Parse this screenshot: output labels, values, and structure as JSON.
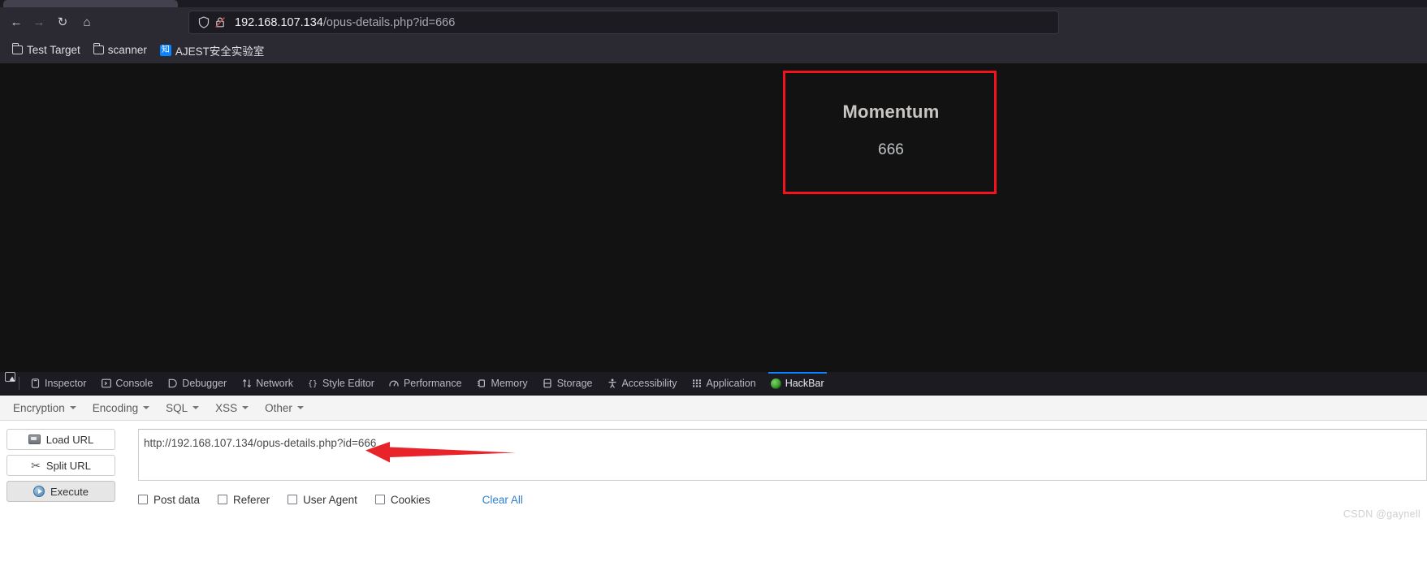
{
  "browser": {
    "nav": {
      "back_label": "←",
      "forward_label": "→",
      "reload_label": "↻",
      "home_label": "⌂"
    },
    "urlbar": {
      "host": "192.168.107.134",
      "path": "/opus-details.php?id=666",
      "shield_icon": "shield-icon",
      "lock_icon": "lock-crossed-icon"
    },
    "bookmarks": [
      {
        "label": "Test Target",
        "icon": "folder-icon"
      },
      {
        "label": "scanner",
        "icon": "folder-icon"
      },
      {
        "label": "AJEST安全实验室",
        "icon": "site-favicon",
        "favicon_text": "知"
      }
    ]
  },
  "page": {
    "title": "Momentum",
    "value": "666",
    "background": "#121212",
    "annotation_box_color": "#f5121a"
  },
  "devtools": {
    "picker_icon": "element-picker-icon",
    "tabs": [
      {
        "label": "Inspector",
        "icon": "inspector-icon",
        "active": false
      },
      {
        "label": "Console",
        "icon": "console-icon",
        "active": false
      },
      {
        "label": "Debugger",
        "icon": "debugger-icon",
        "active": false
      },
      {
        "label": "Network",
        "icon": "network-icon",
        "active": false
      },
      {
        "label": "Style Editor",
        "icon": "style-editor-icon",
        "active": false
      },
      {
        "label": "Performance",
        "icon": "performance-icon",
        "active": false
      },
      {
        "label": "Memory",
        "icon": "memory-icon",
        "active": false
      },
      {
        "label": "Storage",
        "icon": "storage-icon",
        "active": false
      },
      {
        "label": "Accessibility",
        "icon": "accessibility-icon",
        "active": false
      },
      {
        "label": "Application",
        "icon": "application-icon",
        "active": false
      },
      {
        "label": "HackBar",
        "icon": "hackbar-icon",
        "active": true
      }
    ],
    "active_tab_accent": "#0a84ff"
  },
  "hackbar": {
    "menus": [
      {
        "label": "Encryption"
      },
      {
        "label": "Encoding"
      },
      {
        "label": "SQL"
      },
      {
        "label": "XSS"
      },
      {
        "label": "Other"
      }
    ],
    "buttons": [
      {
        "label": "Load URL",
        "icon": "load-url-icon",
        "primary": false
      },
      {
        "label": "Split URL",
        "icon": "scissors-icon",
        "primary": false
      },
      {
        "label": "Execute",
        "icon": "play-icon",
        "primary": true
      }
    ],
    "url_value": "http://192.168.107.134/opus-details.php?id=666",
    "url_placeholder": "",
    "checkboxes": [
      {
        "label": "Post data",
        "checked": false
      },
      {
        "label": "Referer",
        "checked": false
      },
      {
        "label": "User Agent",
        "checked": false
      },
      {
        "label": "Cookies",
        "checked": false
      }
    ],
    "clear_all_label": "Clear All",
    "clear_all_color": "#2f7fd0"
  },
  "annotation": {
    "arrow_color": "#e8232a",
    "arrow_name": "red-arrow-pointing-to-url"
  },
  "watermark": {
    "text": "CSDN @gaynell"
  }
}
